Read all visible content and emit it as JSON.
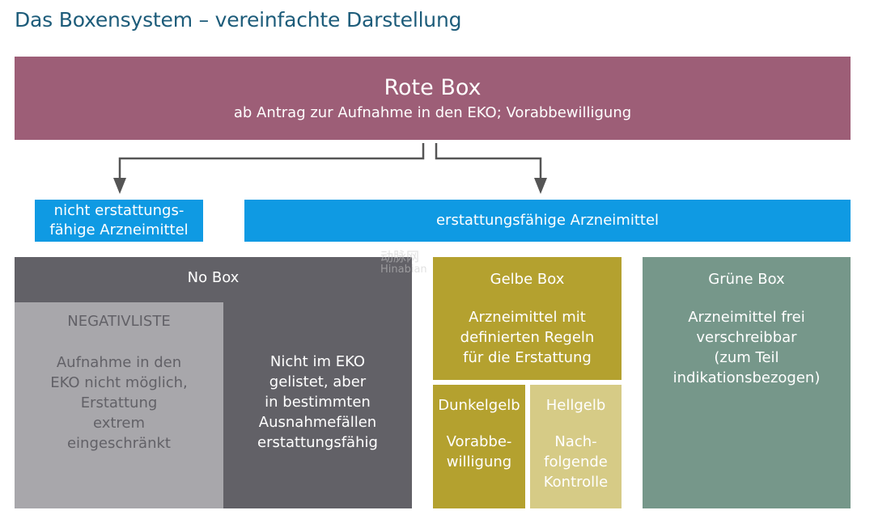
{
  "title": "Das Boxensystem – vereinfachte Darstellung",
  "rote_box": {
    "title": "Rote Box",
    "subtitle": "ab Antrag zur Aufnahme in den EKO; Vorabbewilligung"
  },
  "nicht_erstattungsfaehig": {
    "lines": [
      "nicht erstattungs-",
      "fähige Arzneimittel"
    ]
  },
  "erstattungsfaehig": {
    "label": "erstattungsfähige Arzneimittel"
  },
  "no_box": {
    "title": "No Box",
    "negativliste": {
      "title": "NEGATIVLISTE",
      "lines": [
        "Aufnahme in den",
        "EKO nicht möglich,",
        "Erstattung",
        "extrem",
        "eingeschränkt"
      ]
    },
    "nicht_im_eko": {
      "lines": [
        "Nicht im EKO",
        "gelistet, aber",
        "in bestimmten",
        "Ausnahmefällen",
        "erstattungsfähig"
      ]
    }
  },
  "gelbe_box": {
    "title": "Gelbe Box",
    "lines": [
      "Arzneimittel mit",
      "definierten Regeln",
      "für die Erstattung"
    ],
    "dunkelgelb": {
      "title": "Dunkelgelb",
      "lines": [
        "Vorabbe-",
        "willigung"
      ]
    },
    "hellgelb": {
      "title": "Hellgelb",
      "lines": [
        "Nach-",
        "folgende",
        "Kontrolle"
      ]
    }
  },
  "gruene_box": {
    "title": "Grüne Box",
    "lines": [
      "Arzneimittel frei",
      "verschreibbar",
      "(zum Teil",
      "indikationsbezogen)"
    ]
  },
  "watermark": {
    "line1": "动脉网",
    "line2": "Hinabian"
  },
  "colors": {
    "title": "#1d5c7a",
    "rote_box": "#9d5e77",
    "blue": "#0f9ae3",
    "no_box": "#626167",
    "negativliste": "#a8a7ab",
    "gelbe_box": "#b4a12f",
    "hellgelb": "#d6cb86",
    "gruene_box": "#76978a",
    "arrow": "#555555"
  }
}
